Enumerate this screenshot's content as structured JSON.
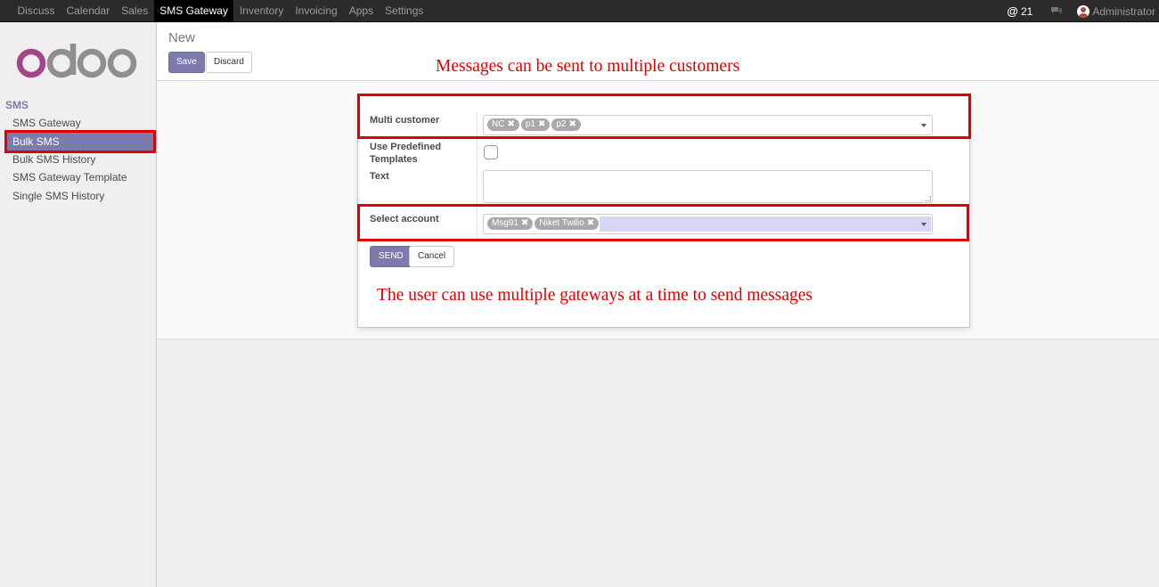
{
  "topbar": {
    "menu": [
      "Discuss",
      "Calendar",
      "Sales",
      "SMS Gateway",
      "Inventory",
      "Invoicing",
      "Apps",
      "Settings"
    ],
    "active_menu": "SMS Gateway",
    "mentions_count": "21",
    "user": "Administrator"
  },
  "sidebar": {
    "section": "SMS",
    "items": [
      {
        "label": "SMS Gateway"
      },
      {
        "label": "Bulk SMS"
      },
      {
        "label": "Bulk SMS History"
      },
      {
        "label": "SMS Gateway Template"
      },
      {
        "label": "Single SMS History"
      }
    ],
    "active_item": "Bulk SMS"
  },
  "control_panel": {
    "breadcrumb": "New",
    "save_label": "Save",
    "discard_label": "Discard"
  },
  "annotations": {
    "top": "Messages can be sent to multiple customers",
    "bottom": "The user can use multiple gateways at a time to send messages"
  },
  "form": {
    "multi_customer_label": "Multi customer",
    "multi_customer_tags": [
      "NC",
      "p1",
      "p2"
    ],
    "use_templates_label_line1": "Use Predefined",
    "use_templates_label_line2": "Templates",
    "use_templates_checked": false,
    "text_label": "Text",
    "text_value": "",
    "select_account_label": "Select account",
    "account_tags": [
      "Msg91",
      "Niket Twilio"
    ],
    "send_label": "SEND",
    "cancel_label": "Cancel"
  },
  "colors": {
    "brand": "#7c7bad",
    "annotation": "#e10000",
    "topbar": "#2b2b2b"
  }
}
